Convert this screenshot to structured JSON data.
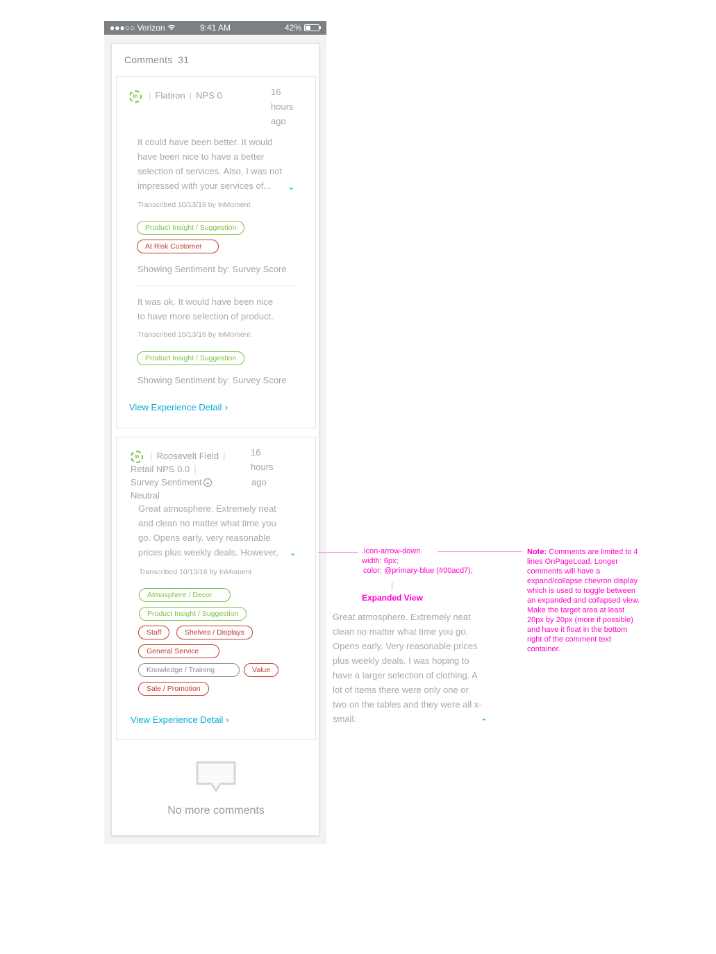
{
  "status_bar": {
    "carrier": "●●●○○ Verizon",
    "wifi_icon": "wifi-icon",
    "time": "9:41 AM",
    "battery": "42%"
  },
  "panel": {
    "title": "Comments",
    "count": "31"
  },
  "card1": {
    "location": "Flatiron",
    "nps": "NPS 0",
    "time_ago": [
      "16",
      "hours",
      "ago"
    ],
    "comment1": {
      "lines": [
        "It could have been better. It would",
        "have been nice to have a better",
        "selection of services. Also, I was not",
        "impressed with your services of..."
      ],
      "transcribed": "Transcribed 10/13/16 by InMoment",
      "tags": [
        "Product Insight / Suggestion",
        "At Risk Customer"
      ],
      "sentiment": "Showing Sentiment by: Survey Score"
    },
    "comment2": {
      "lines": [
        "It was ok. It would have been nice",
        "to have more selection of product."
      ],
      "transcribed": "Transcribed 10/13/16 by InMoment",
      "tags": [
        "Product Insight / Suggestion"
      ],
      "sentiment": "Showing Sentiment by: Survey Score"
    },
    "link": "View Experience Detail"
  },
  "card2": {
    "location": "Roosevelt Field",
    "retail_nps": "Retail NPS 0.0",
    "survey_sentiment": "Survey Sentiment",
    "sentiment_value": "Neutral",
    "time_ago": [
      "16",
      "hours",
      "ago"
    ],
    "lines": [
      "Great atmosphere. Extremely neat",
      "and clean no matter what time you",
      "go. Opens early. very reasonable",
      "prices plus weekly deals. However,"
    ],
    "transcribed": "Transcribed 10/13/16 by InMoment",
    "tags": [
      {
        "label": "Atmosphere / Decor",
        "color": "green"
      },
      {
        "label": "Product Insight / Suggestion",
        "color": "green"
      },
      {
        "label": "Staff",
        "color": "red"
      },
      {
        "label": "Shelves / Displays",
        "color": "red"
      },
      {
        "label": "General Service",
        "color": "red"
      },
      {
        "label": "Knowledge / Training",
        "color": "gray"
      },
      {
        "label": "Value",
        "color": "red"
      },
      {
        "label": "Sale / Promotion",
        "color": "red"
      }
    ],
    "link": "View Experience Detail"
  },
  "empty_state": {
    "icon": "speech-bubble-icon",
    "text": "No more comments"
  },
  "annotations": {
    "code_lines": [
      ".icon-arrow-down",
      "width: 6px;",
      "color: @primary-blue (#00acd7);"
    ],
    "expanded_title": "Expanded View",
    "expanded_lines": [
      "Great atmosphere. Extremely neat",
      "clean no matter what time you go.",
      "Opens early. Very reasonable prices",
      "plus weekly deals. I was hoping to",
      "have a larger selection of clothing. A",
      "lot of items there were only one or",
      "two on the tables and they were all x-",
      "small."
    ],
    "note_label": "Note:",
    "note_text": "Comments are limited to 4 lines OnPageLoad. Longer comments will have a expand/collapse chevron display which is used to toggle between an expanded and collapsed view. Make the target area at least 20px by 20px (more if possible) and have it float in the bottom right of the comment text container."
  },
  "colors": {
    "primary_blue": "#00acd7",
    "tag_green": "#7dc142",
    "tag_red": "#c0392b",
    "annotation": "#ff00cc",
    "status_bar": "#7b8084"
  }
}
